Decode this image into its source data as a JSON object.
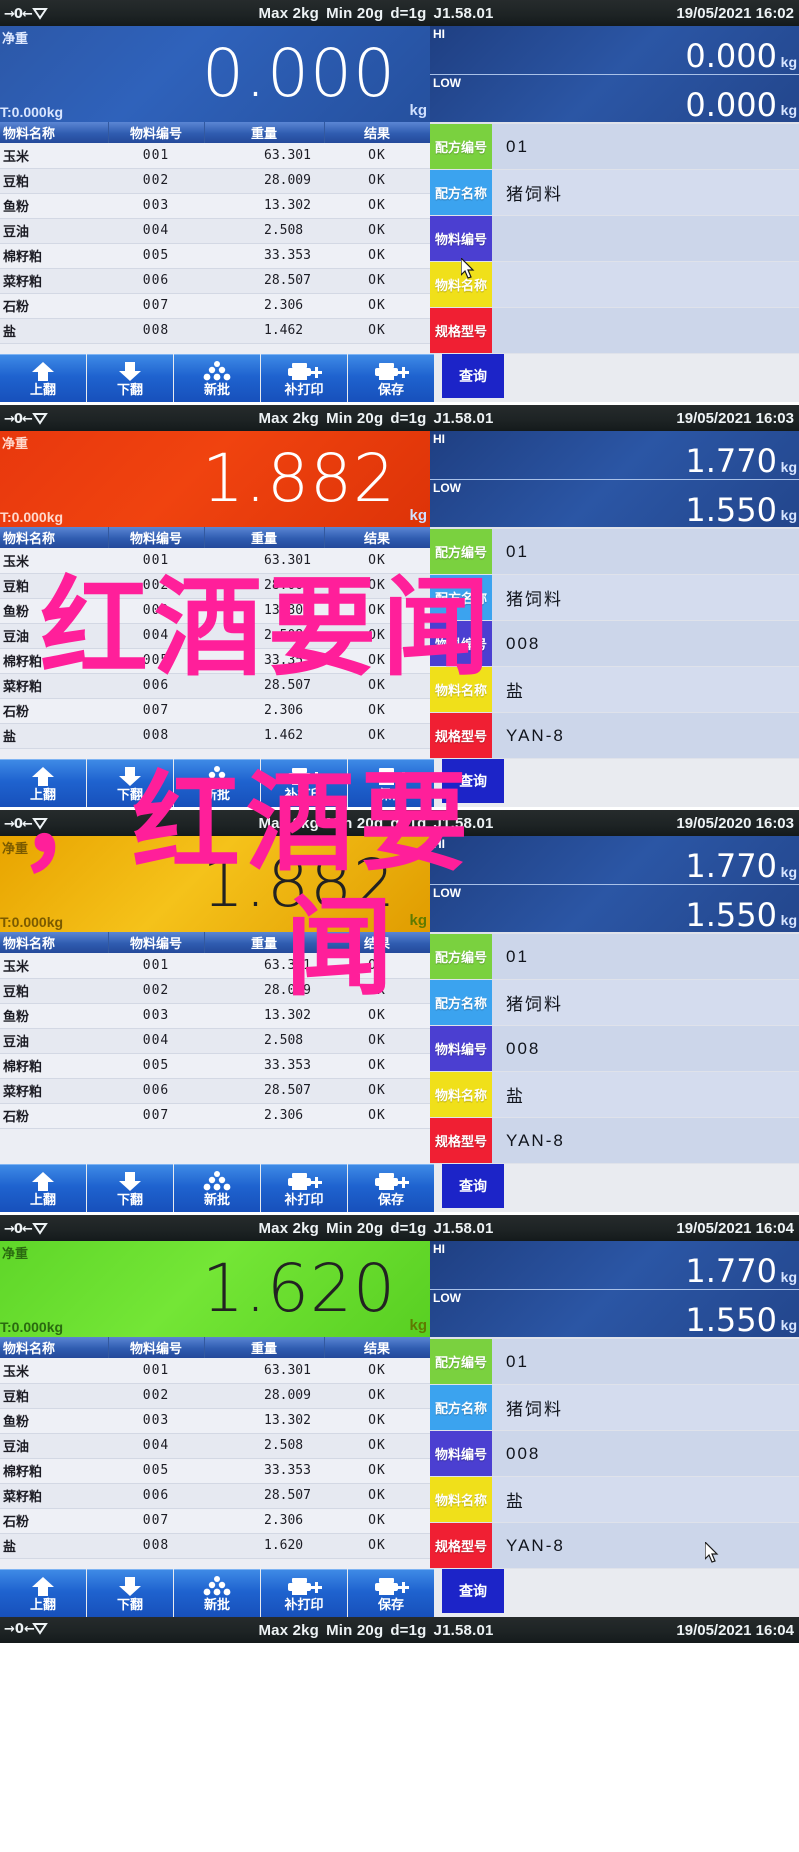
{
  "device": {
    "spec_line": [
      "Max 2kg",
      "Min 20g",
      "d=1g",
      "J1.58.01"
    ],
    "zero_icon": "zero-stable-icon",
    "net_label": "净重",
    "tare_label": "T:0.000kg",
    "unit": "kg",
    "hi_tag": "HI",
    "low_tag": "LOW"
  },
  "table": {
    "headers": [
      "物料名称",
      "物料编号",
      "重量",
      "结果"
    ],
    "rows_full": [
      {
        "name": "玉米",
        "code": "001",
        "weight": "63.301",
        "result": "OK"
      },
      {
        "name": "豆粕",
        "code": "002",
        "weight": "28.009",
        "result": "OK"
      },
      {
        "name": "鱼粉",
        "code": "003",
        "weight": "13.302",
        "result": "OK"
      },
      {
        "name": "豆油",
        "code": "004",
        "weight": "2.508",
        "result": "OK"
      },
      {
        "name": "棉籽粕",
        "code": "005",
        "weight": "33.353",
        "result": "OK"
      },
      {
        "name": "菜籽粕",
        "code": "006",
        "weight": "28.507",
        "result": "OK"
      },
      {
        "name": "石粉",
        "code": "007",
        "weight": "2.306",
        "result": "OK"
      },
      {
        "name": "盐",
        "code": "008",
        "weight": "1.462",
        "result": "OK"
      }
    ],
    "rows_salt_1620": [
      {
        "name": "玉米",
        "code": "001",
        "weight": "63.301",
        "result": "OK"
      },
      {
        "name": "豆粕",
        "code": "002",
        "weight": "28.009",
        "result": "OK"
      },
      {
        "name": "鱼粉",
        "code": "003",
        "weight": "13.302",
        "result": "OK"
      },
      {
        "name": "豆油",
        "code": "004",
        "weight": "2.508",
        "result": "OK"
      },
      {
        "name": "棉籽粕",
        "code": "005",
        "weight": "33.353",
        "result": "OK"
      },
      {
        "name": "菜籽粕",
        "code": "006",
        "weight": "28.507",
        "result": "OK"
      },
      {
        "name": "石粉",
        "code": "007",
        "weight": "2.306",
        "result": "OK"
      },
      {
        "name": "盐",
        "code": "008",
        "weight": "1.620",
        "result": "OK"
      }
    ],
    "rows_seven": [
      {
        "name": "玉米",
        "code": "001",
        "weight": "63.301",
        "result": "OK"
      },
      {
        "name": "豆粕",
        "code": "002",
        "weight": "28.009",
        "result": "OK"
      },
      {
        "name": "鱼粉",
        "code": "003",
        "weight": "13.302",
        "result": "OK"
      },
      {
        "name": "豆油",
        "code": "004",
        "weight": "2.508",
        "result": "OK"
      },
      {
        "name": "棉籽粕",
        "code": "005",
        "weight": "33.353",
        "result": "OK"
      },
      {
        "name": "菜籽粕",
        "code": "006",
        "weight": "28.507",
        "result": "OK"
      },
      {
        "name": "石粉",
        "code": "007",
        "weight": "2.306",
        "result": "OK"
      }
    ]
  },
  "field_labels": {
    "recipe_code": "配方编号",
    "recipe_name": "配方名称",
    "material_code": "物料编号",
    "material_name": "物料名称",
    "spec_model": "规格型号"
  },
  "field_colors": {
    "recipe_code": "#7ad13f",
    "recipe_name": "#3ba3ef",
    "material_code": "#4b3fd1",
    "material_name": "#f0e01a",
    "spec_model": "#f01f33"
  },
  "toolbar": {
    "buttons": [
      {
        "label": "上翻",
        "icon": "arrow-up-icon"
      },
      {
        "label": "下翻",
        "icon": "arrow-down-icon"
      },
      {
        "label": "新批",
        "icon": "stack-batch-icon"
      },
      {
        "label": "补打印",
        "icon": "printer-plus-icon"
      },
      {
        "label": "保存",
        "icon": "printer-plus-icon"
      }
    ],
    "query_label": "查询"
  },
  "panels": [
    {
      "id": "panel-1",
      "datetime": "19/05/2021  16:02",
      "weight": "0.000",
      "weight_color": "blue",
      "hi": "0.000",
      "low": "0.000",
      "tare": "T:0.000kg",
      "fields": {
        "recipe_code": "01",
        "recipe_name": "猪饲料",
        "material_code": "",
        "material_name": "",
        "spec_model": ""
      },
      "rows_key": "rows_full",
      "cursor": true
    },
    {
      "id": "panel-2",
      "datetime": "19/05/2021  16:03",
      "weight": "1.882",
      "weight_color": "red",
      "hi": "1.770",
      "low": "1.550",
      "tare": "T:0.000kg",
      "fields": {
        "recipe_code": "01",
        "recipe_name": "猪饲料",
        "material_code": "008",
        "material_name": "盐",
        "spec_model": "YAN-8"
      },
      "rows_key": "rows_full",
      "cursor": false
    },
    {
      "id": "panel-3",
      "datetime": "19/05/2020  16:03",
      "weight": "1.882",
      "weight_color": "yellow",
      "hi": "1.770",
      "low": "1.550",
      "tare": "T:0.000kg",
      "fields": {
        "recipe_code": "01",
        "recipe_name": "猪饲料",
        "material_code": "008",
        "material_name": "盐",
        "spec_model": "YAN-8"
      },
      "rows_key": "rows_seven",
      "cursor": false
    },
    {
      "id": "panel-4",
      "datetime": "19/05/2021  16:04",
      "weight": "1.620",
      "weight_color": "green",
      "hi": "1.770",
      "low": "1.550",
      "tare": "T:0.000kg",
      "fields": {
        "recipe_code": "01",
        "recipe_name": "猪饲料",
        "material_code": "008",
        "material_name": "盐",
        "spec_model": "YAN-8"
      },
      "rows_key": "rows_salt_1620",
      "cursor": true
    }
  ],
  "watermark": {
    "line1": "红酒要闻",
    "line2": "，红酒要",
    "line3": "闻",
    "color": "#ff1f9a"
  }
}
